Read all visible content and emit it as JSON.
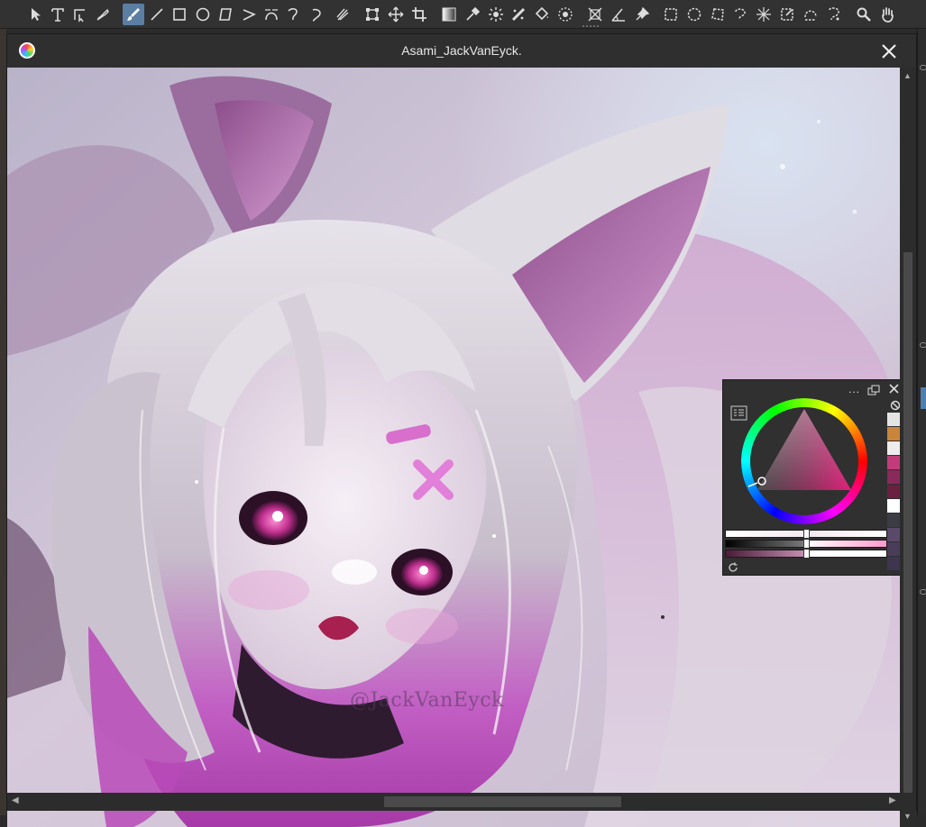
{
  "toolbar": {
    "tools": [
      {
        "name": "move-tool-icon"
      },
      {
        "name": "text-tool-icon"
      },
      {
        "name": "edit-shapes-icon"
      },
      {
        "name": "calligraphy-icon"
      },
      {
        "name": "freehand-brush-icon",
        "active": true
      },
      {
        "name": "line-tool-icon"
      },
      {
        "name": "rectangle-tool-icon"
      },
      {
        "name": "ellipse-tool-icon"
      },
      {
        "name": "polygon-tool-icon"
      },
      {
        "name": "polyline-tool-icon"
      },
      {
        "name": "bezier-curve-icon"
      },
      {
        "name": "freehand-path-icon"
      },
      {
        "name": "dynamic-brush-icon"
      },
      {
        "name": "multibrush-icon"
      },
      {
        "name": "transform-icon"
      },
      {
        "name": "move-layer-icon"
      },
      {
        "name": "crop-icon"
      },
      {
        "name": "gradient-icon"
      },
      {
        "name": "color-sampler-icon"
      },
      {
        "name": "colorize-mask-icon"
      },
      {
        "name": "smart-patch-icon"
      },
      {
        "name": "fill-icon"
      },
      {
        "name": "enclose-fill-icon"
      },
      {
        "name": "assistant-tool-icon"
      },
      {
        "name": "measure-icon"
      },
      {
        "name": "reference-icon"
      },
      {
        "name": "rect-select-icon"
      },
      {
        "name": "ellipse-select-icon"
      },
      {
        "name": "polygon-select-icon"
      },
      {
        "name": "freehand-select-icon"
      },
      {
        "name": "contiguous-select-icon"
      },
      {
        "name": "similar-select-icon"
      },
      {
        "name": "bezier-select-icon"
      },
      {
        "name": "magnetic-select-icon"
      },
      {
        "name": "zoom-icon"
      },
      {
        "name": "pan-icon"
      }
    ]
  },
  "document": {
    "title": "Asami_JackVanEyck."
  },
  "canvas": {
    "watermark": "@JackVanEyck"
  },
  "color_panel": {
    "dots_label": "...",
    "swatches": [
      "#e4e4e4",
      "#c9863a",
      "#ededed",
      "#c23c7b",
      "#8a2a5a",
      "#6a2040",
      "#ffffff",
      "#3c3c44",
      "#5a4a6a",
      "#4a3d5a",
      "#3e3550"
    ],
    "selected_color": "#e58fc3"
  }
}
